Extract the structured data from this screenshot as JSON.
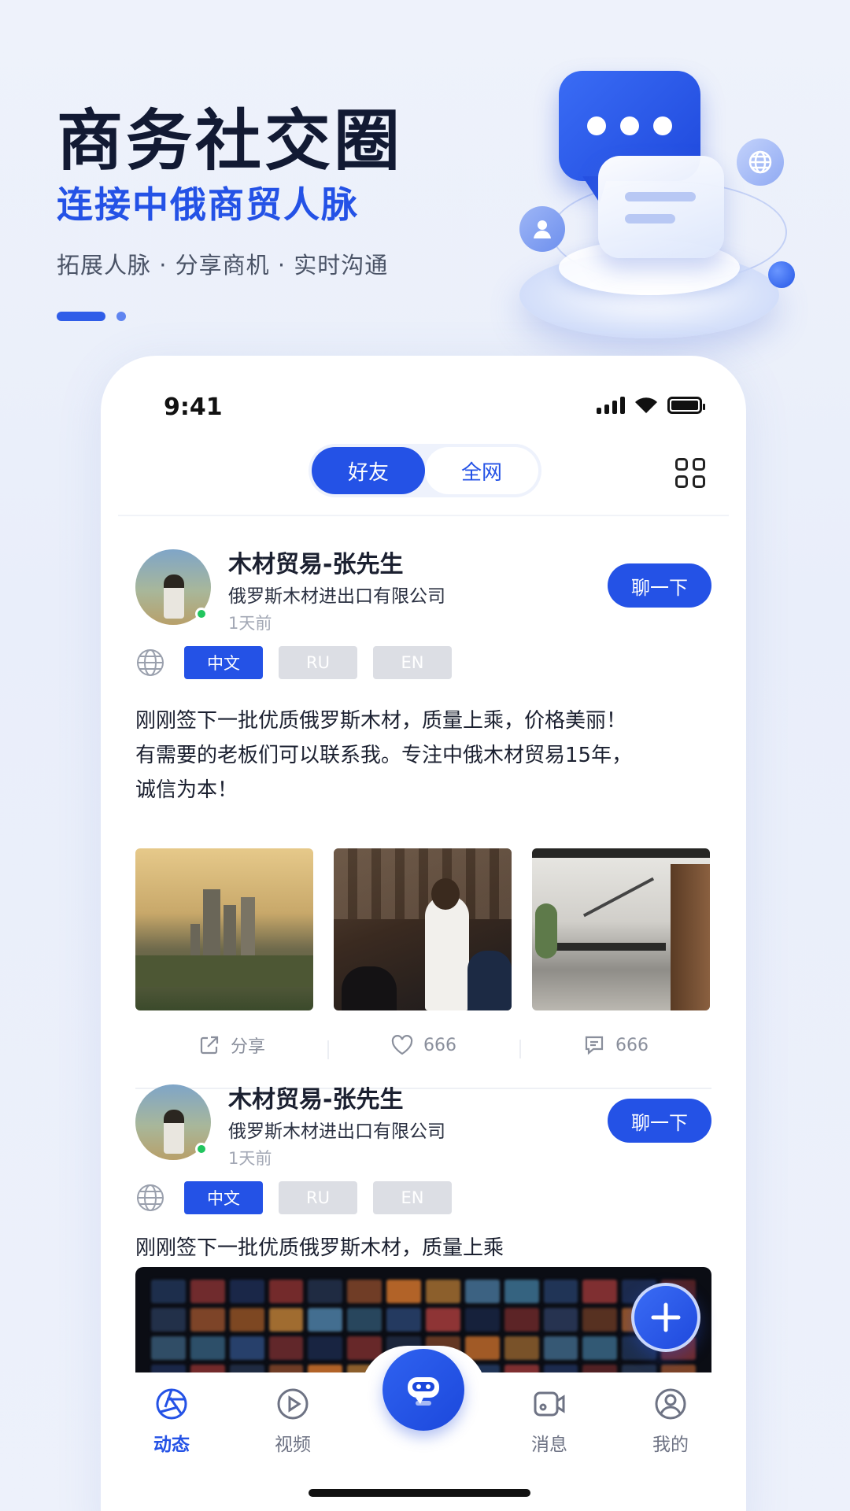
{
  "hero": {
    "title": "商务社交圈",
    "subtitle": "连接中俄商贸人脉",
    "tagline": "拓展人脉 · 分享商机 · 实时沟通"
  },
  "status_bar": {
    "time": "9:41"
  },
  "tabs_top": {
    "friends": "好友",
    "all": "全网",
    "active": "好友"
  },
  "posts": [
    {
      "name": "木材贸易-张先生",
      "company": "俄罗斯木材进出口有限公司",
      "time": "1天前",
      "chat_label": "聊一下",
      "langs": [
        "中文",
        "RU",
        "EN"
      ],
      "active_lang": "中文",
      "text": [
        "刚刚签下一批优质俄罗斯木材，质量上乘，价格美丽！",
        "有需要的老板们可以联系我。专注中俄木材贸易15年，",
        "诚信为本！"
      ],
      "share_label": "分享",
      "likes": "666",
      "comments": "666"
    },
    {
      "name": "木材贸易-张先生",
      "company": "俄罗斯木材进出口有限公司",
      "time": "1天前",
      "chat_label": "聊一下",
      "langs": [
        "中文",
        "RU",
        "EN"
      ],
      "active_lang": "中文",
      "text": [
        "刚刚签下一批优质俄罗斯木材，质量上乘"
      ]
    }
  ],
  "bottom_nav": {
    "items": [
      "动态",
      "视频",
      "消息",
      "我的"
    ],
    "active": "动态"
  },
  "colors": {
    "accent": "#2452e6",
    "online": "#22c55e",
    "chip_inactive": "#dcdee4"
  },
  "icons": [
    "grid-icon",
    "globe-icon",
    "share-icon",
    "heart-icon",
    "comment-icon",
    "plus-icon",
    "moments-icon",
    "play-icon",
    "robot-icon",
    "video-camera-icon",
    "profile-icon"
  ]
}
